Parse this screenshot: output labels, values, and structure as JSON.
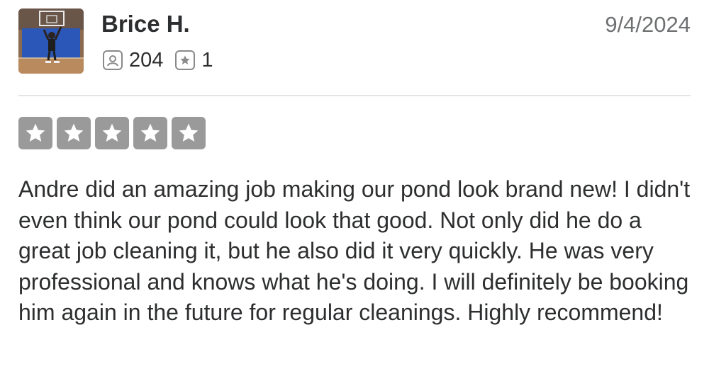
{
  "review": {
    "user": {
      "name": "Brice H.",
      "avatar_alt": "avatar",
      "review_count": "204",
      "photo_count": "1"
    },
    "date": "9/4/2024",
    "rating": {
      "value": 5,
      "max": 5,
      "state": "empty-gray"
    },
    "text": "Andre did an amazing job making our pond look brand new! I didn't even think our pond could look that good. Not only did he do a great job cleaning it, but he also did it very quickly. He was very professional and knows what he's doing. I will definitely be booking him again in the future for regular cleanings. Highly recommend!"
  },
  "icons": {
    "reviews": "user-review-icon",
    "photos": "star-badge-icon",
    "rating_star": "star-icon"
  },
  "colors": {
    "star_box": "#9a9a9a",
    "date": "#6e7072",
    "text": "#2d2e2f",
    "divider": "#e4e4e4"
  }
}
